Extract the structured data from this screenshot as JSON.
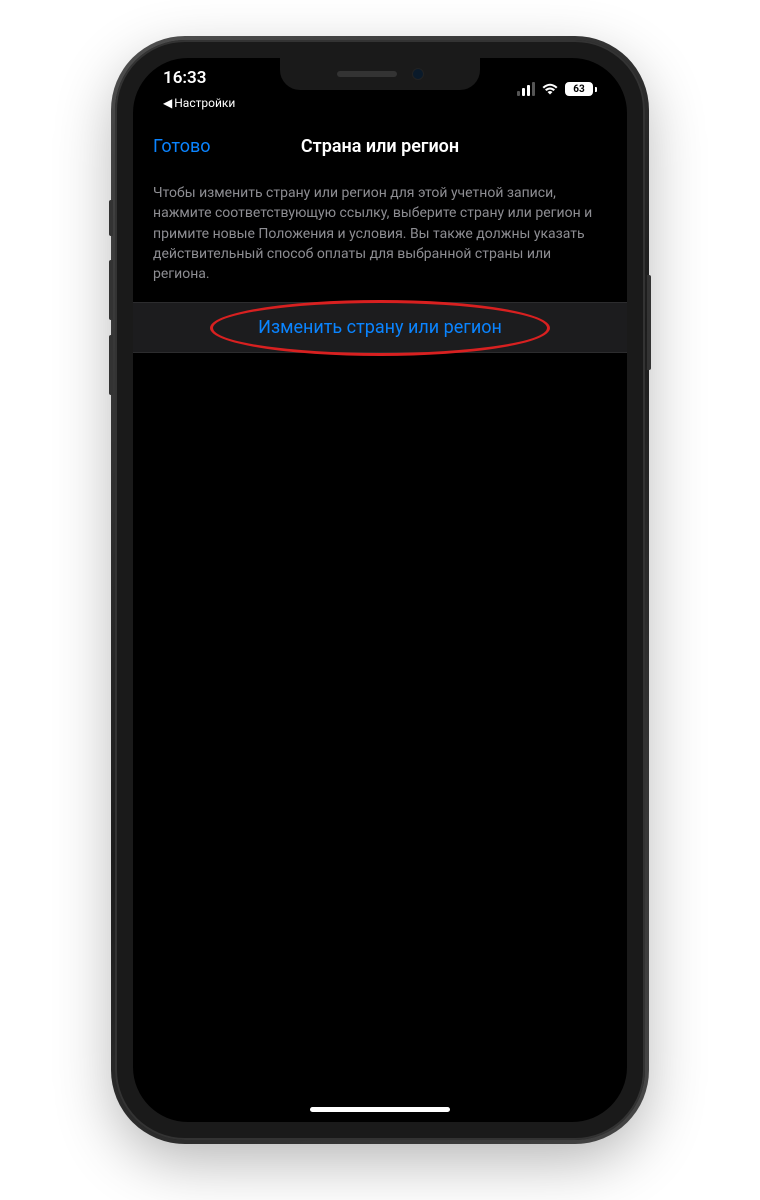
{
  "status_bar": {
    "time": "16:33",
    "back_app": "Настройки",
    "battery_level": "63"
  },
  "nav": {
    "done_label": "Готово",
    "title": "Страна или регион"
  },
  "description": "Чтобы изменить страну или регион для этой учетной записи, нажмите соответствующую ссылку, выберите страну или регион и примите новые Положения и условия. Вы также должны указать действительный способ оплаты для выбранной страны или региона.",
  "action": {
    "change_label": "Изменить страну или регион"
  }
}
